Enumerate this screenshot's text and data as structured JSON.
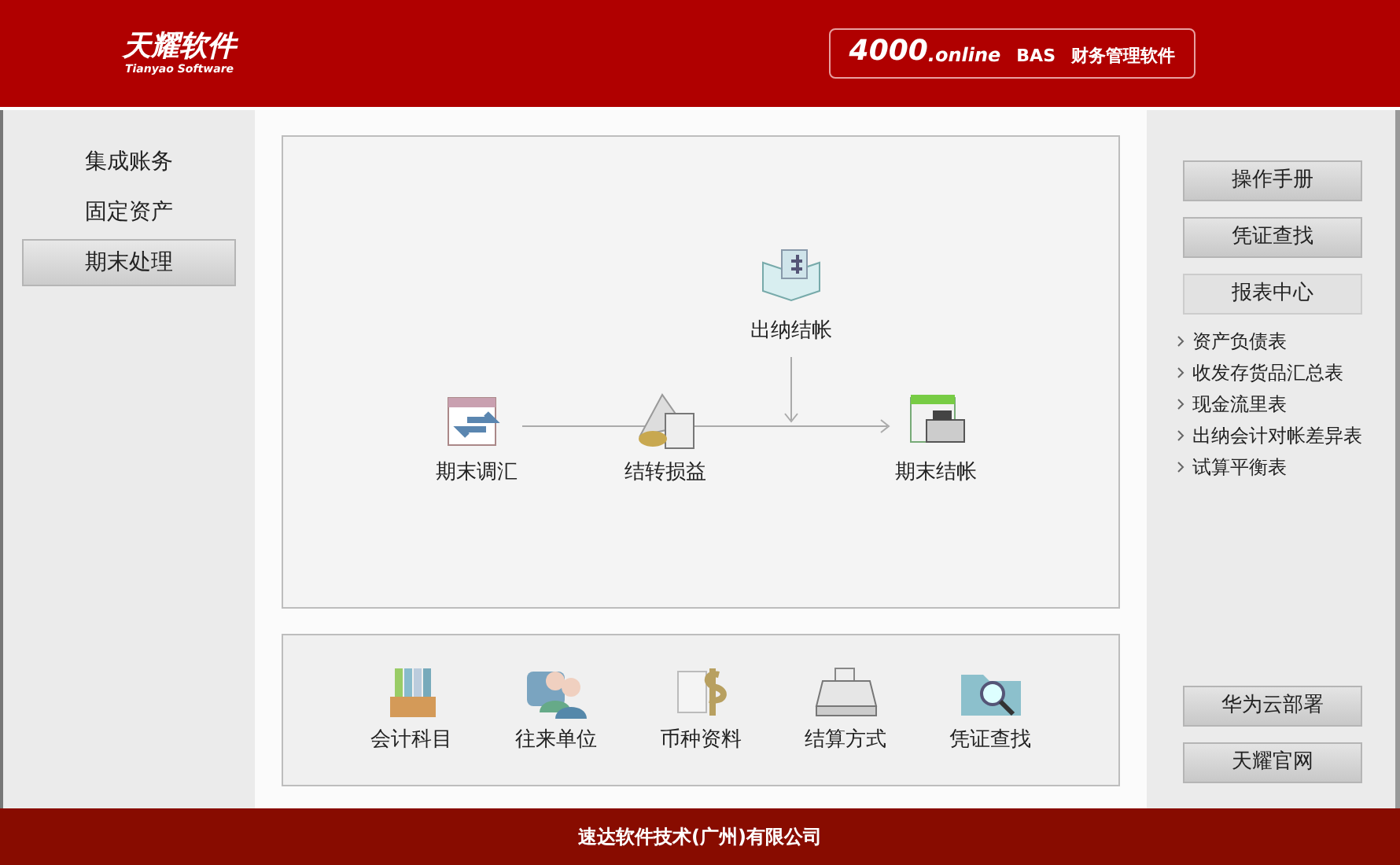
{
  "header": {
    "logo": "天耀软件",
    "logo_sub": "Tianyao Software",
    "badge": {
      "number": "4000",
      "suffix": ".online",
      "product": "BAS",
      "title": "财务管理软件"
    }
  },
  "sidebar": {
    "items": [
      {
        "label": "集成账务",
        "selected": false
      },
      {
        "label": "固定资产",
        "selected": false
      },
      {
        "label": "期末处理",
        "selected": true
      }
    ]
  },
  "flow": {
    "nodes": [
      {
        "label": "期末调汇"
      },
      {
        "label": "结转损益"
      },
      {
        "label": "出纳结帐"
      },
      {
        "label": "期末结帐"
      }
    ]
  },
  "shortcuts": [
    {
      "label": "会计科目"
    },
    {
      "label": "往来单位"
    },
    {
      "label": "币种资料"
    },
    {
      "label": "结算方式"
    },
    {
      "label": "凭证查找"
    }
  ],
  "right_panel": {
    "buttons": [
      "操作手册",
      "凭证查找"
    ],
    "report_center": "报表中心",
    "reports": [
      "资产负债表",
      "收发存货品汇总表",
      "现金流里表",
      "出纳会计对帐差异表",
      "试算平衡表"
    ],
    "bottom_buttons": [
      "华为云部署",
      "天耀官网"
    ]
  },
  "footer": "速达软件技术(广州)有限公司"
}
